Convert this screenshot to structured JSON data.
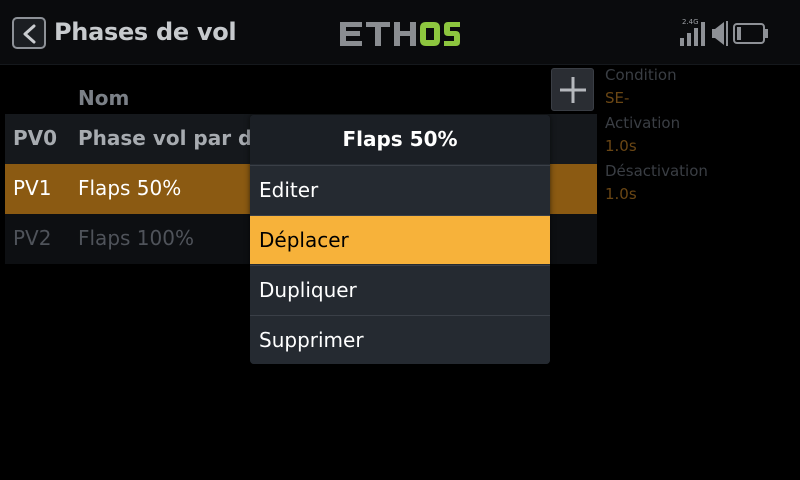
{
  "header": {
    "title": "Phases de vol",
    "logo_text_left": "ETH",
    "logo_text_right": "OS",
    "signal_label": "2.4G"
  },
  "table": {
    "column_name": "Nom",
    "rows": [
      {
        "id": "PV0",
        "name": "Phase vol par dét"
      },
      {
        "id": "PV1",
        "name": "Flaps 50%"
      },
      {
        "id": "PV2",
        "name": "Flaps 100%"
      }
    ]
  },
  "side_panel": {
    "condition_label": "Condition",
    "condition_value": "SE-",
    "activation_label": "Activation",
    "activation_value": "1.0s",
    "deactivation_label": "Désactivation",
    "deactivation_value": "1.0s"
  },
  "popup": {
    "title": "Flaps 50%",
    "items": [
      {
        "label": "Editer"
      },
      {
        "label": "Déplacer"
      },
      {
        "label": "Dupliquer"
      },
      {
        "label": "Supprimer"
      }
    ],
    "selected_index": 1
  },
  "icons": {
    "back": "chevron-left-icon",
    "add": "plus-icon",
    "signal": "signal-bars-icon",
    "volume": "speaker-icon",
    "battery": "battery-icon"
  },
  "colors": {
    "accent": "#f7b23a",
    "selected_row": "#8b5a12",
    "logo_green": "#8dc63f",
    "logo_grey": "#8a8d91"
  }
}
